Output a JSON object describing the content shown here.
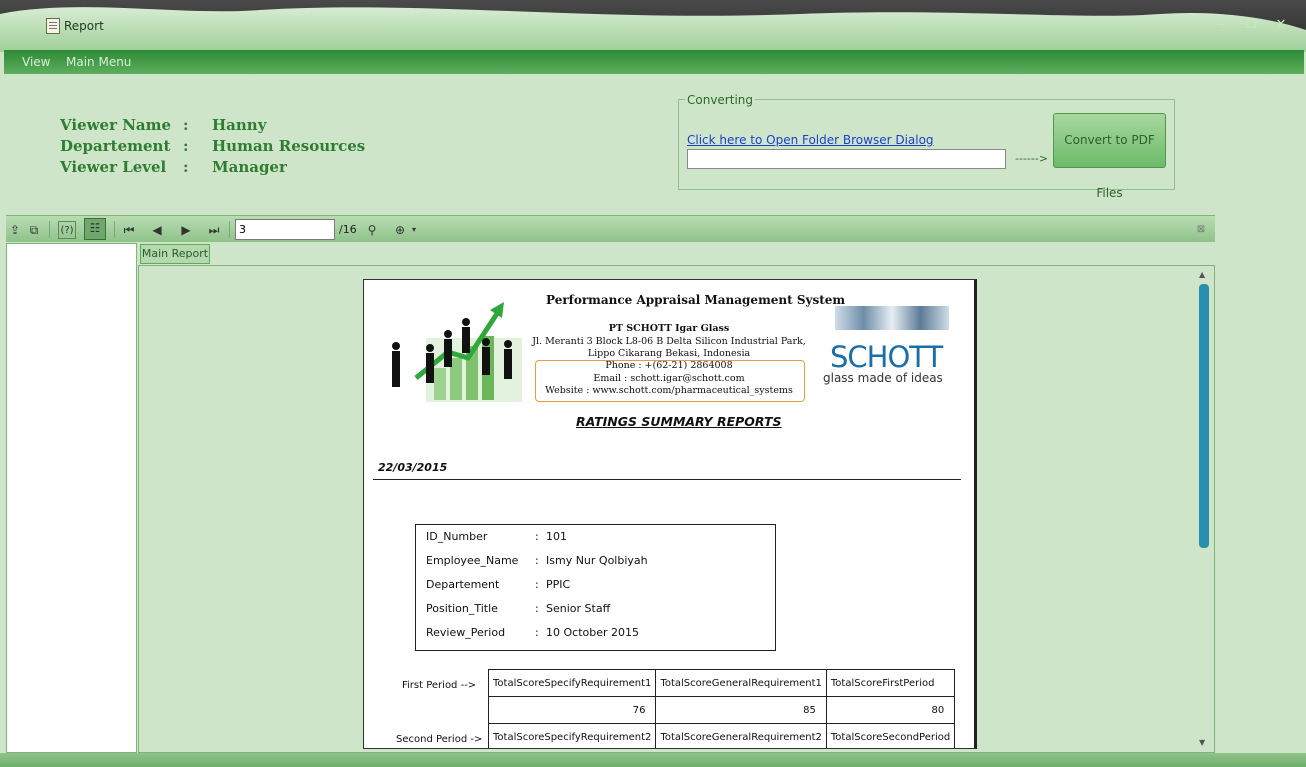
{
  "window": {
    "title": "Report",
    "controls": [
      "–",
      "☐",
      "✕"
    ]
  },
  "menu": {
    "items": [
      "View",
      "Main Menu"
    ]
  },
  "viewer_info": [
    {
      "label": "Viewer Name",
      "sep": ":",
      "value": "Hanny"
    },
    {
      "label": "Departement",
      "sep": ":",
      "value": "Human Resources"
    },
    {
      "label": "Viewer Level",
      "sep": ":",
      "value": "Manager"
    }
  ],
  "converting": {
    "title": "Converting",
    "link": "Click here to Open Folder Browser Dialog",
    "folder_path": "",
    "arrow": "------>",
    "button": "Convert to PDF Files"
  },
  "toolbar": {
    "current_page": "3",
    "total_pages": "/16"
  },
  "tabs": {
    "main_report": "Main Report"
  },
  "report": {
    "system_title": "Performance Appraisal Management System",
    "company": "PT SCHOTT Igar Glass",
    "address1": "Jl. Meranti 3 Block L8-06 B Delta Silicon Industrial Park,",
    "address2": "Lippo Cikarang Bekasi, Indonesia",
    "phone": "Phone : +(62-21) 2864008",
    "email": "Email : schott.igar@schott.com",
    "website": "Website : www.schott.com/pharmaceutical_systems",
    "logo_name": "SCHOTT",
    "logo_tagline": "glass made of ideas",
    "heading": "RATINGS SUMMARY REPORTS",
    "date": "22/03/2015",
    "employee": [
      {
        "label": "ID_Number",
        "value": "101"
      },
      {
        "label": "Employee_Name",
        "value": "Ismy Nur Qolbiyah"
      },
      {
        "label": "Departement",
        "value": "PPIC"
      },
      {
        "label": "Position_Title",
        "value": "Senior Staff"
      },
      {
        "label": "Review_Period",
        "value": "10 October 2015"
      }
    ],
    "first_period_label": "First Period  -->",
    "second_period_label": "Second Period ->",
    "first_headers": [
      "TotalScoreSpecifyRequirement1",
      "TotalScoreGeneralRequirement1",
      "TotalScoreFirstPeriod"
    ],
    "first_values": [
      "76",
      "85",
      "80"
    ],
    "second_headers": [
      "TotalScoreSpecifyRequirement2",
      "TotalScoreGeneralRequirement2",
      "TotalScoreSecondPeriod"
    ]
  }
}
